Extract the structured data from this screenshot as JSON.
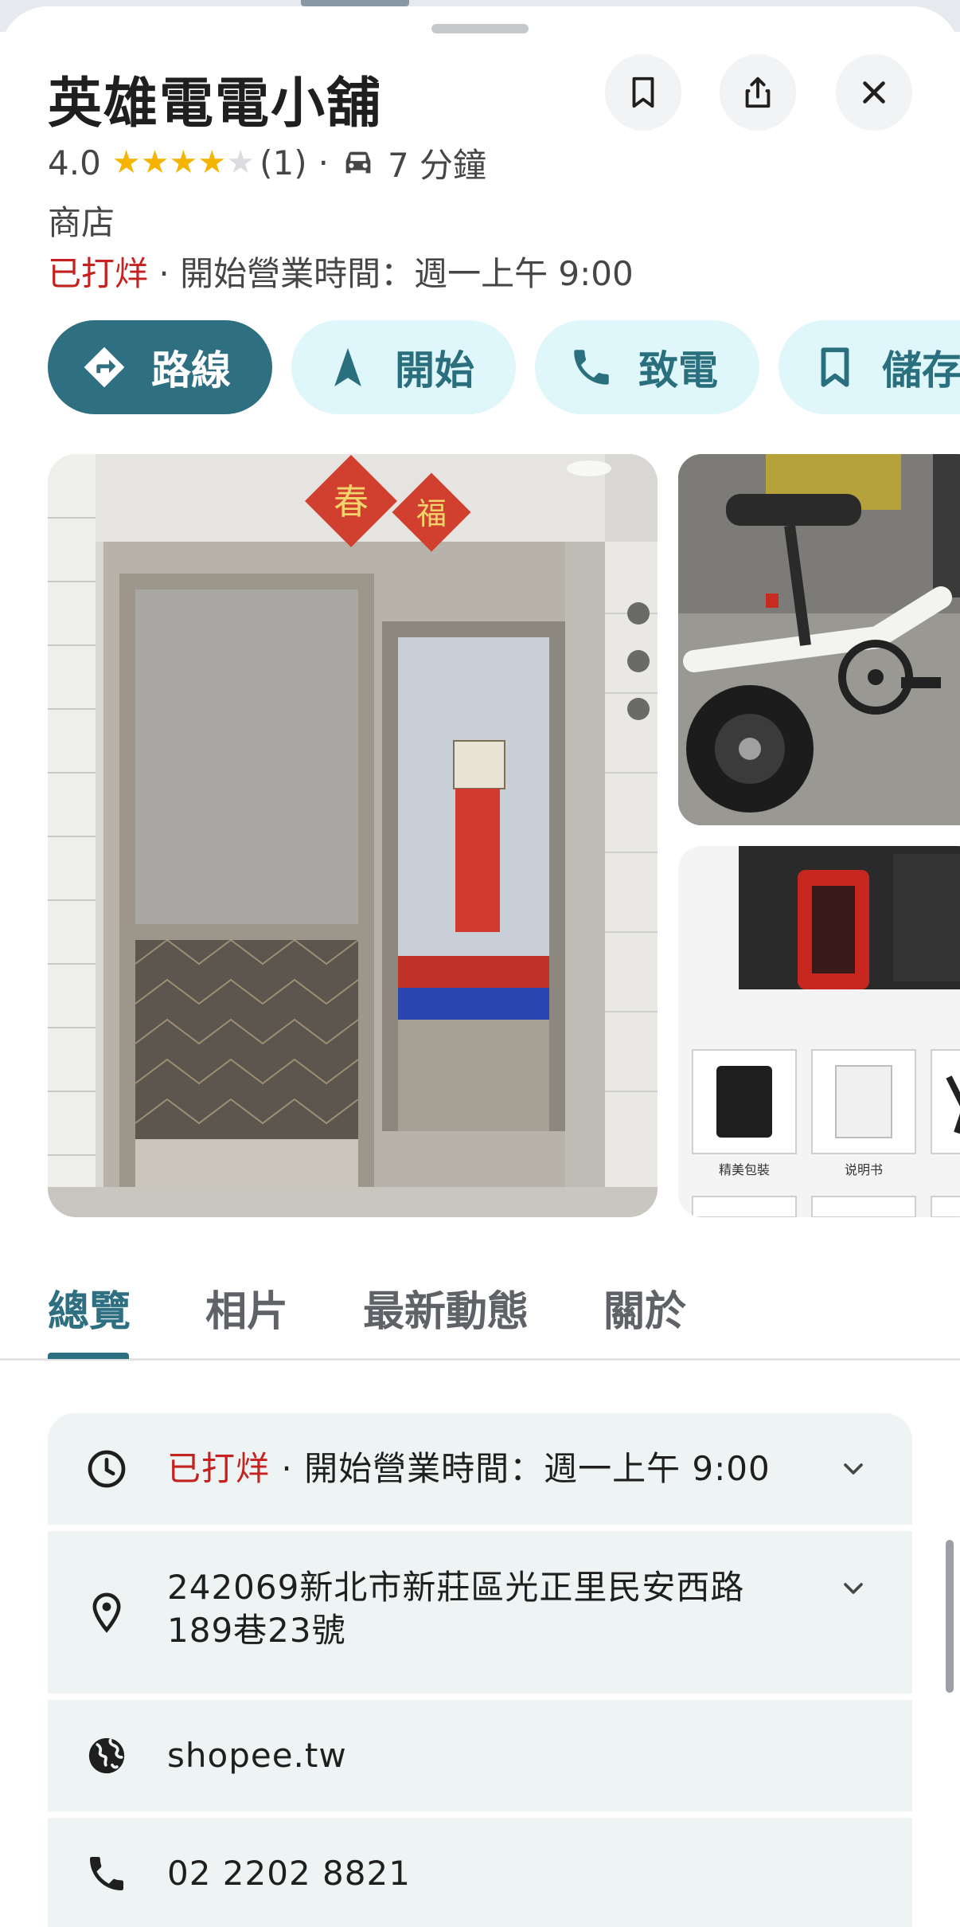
{
  "place": {
    "name": "英雄電電小舖",
    "rating": "4.0",
    "rating_value": 4,
    "rating_max": 5,
    "review_count": "(1)",
    "separator": "·",
    "drive_time": "7 分鐘",
    "category": "商店",
    "status_closed": "已打烊",
    "status_open_info": " · 開始營業時間：週一上午 9:00"
  },
  "header_buttons": {
    "save_icon": "bookmark-icon",
    "share_icon": "share-icon",
    "close_icon": "close-icon"
  },
  "actions": [
    {
      "label": "路線",
      "icon": "directions-icon"
    },
    {
      "label": "開始",
      "icon": "navigation-arrow-icon"
    },
    {
      "label": "致電",
      "icon": "phone-icon"
    },
    {
      "label": "儲存",
      "icon": "bookmark-icon"
    }
  ],
  "photos": {
    "main": {
      "sign1": "春",
      "sign2": "福"
    },
    "side2": {
      "caption1": "精美包裝",
      "caption2": "说明书"
    }
  },
  "tabs": [
    {
      "label": "總覽",
      "active": true
    },
    {
      "label": "相片",
      "active": false
    },
    {
      "label": "最新動態",
      "active": false
    },
    {
      "label": "關於",
      "active": false
    }
  ],
  "info": {
    "hours": {
      "closed": "已打烊",
      "detail": " · 開始營業時間：週一上午 9:00"
    },
    "address_line1": "242069新北市新莊區光正里民安西路",
    "address_line2": "189巷23號",
    "website": "shopee.tw",
    "phone": "02 2202 8821"
  },
  "colors": {
    "accent": "#2e6f82",
    "chip_bg": "#dff6fb",
    "closed_red": "#c5221f",
    "star": "#f4b400",
    "card_bg": "#eef3f4"
  }
}
